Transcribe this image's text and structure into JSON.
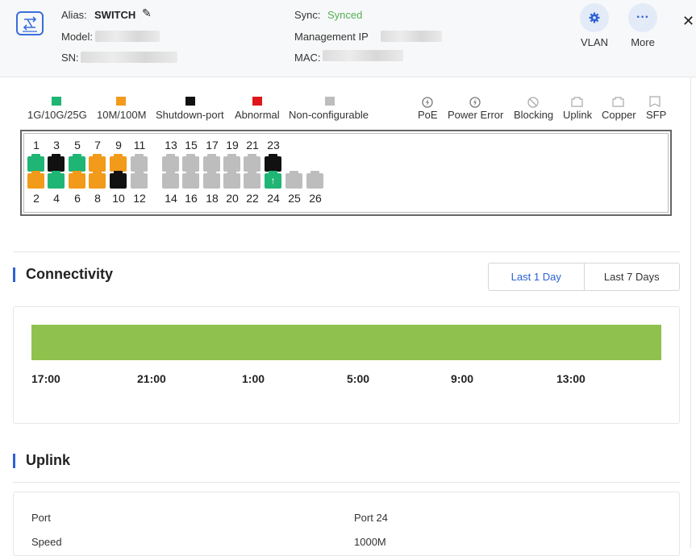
{
  "header": {
    "alias_label": "Alias:",
    "alias_value": "SWITCH",
    "model_label": "Model:",
    "sn_label": "SN:",
    "sync_label": "Sync:",
    "sync_value": "Synced",
    "mgmt_label": "Management IP",
    "mac_label": "MAC:",
    "vlan_label": "VLAN",
    "more_label": "More",
    "more_glyph": "···",
    "close_glyph": "✕",
    "sync_color": "#52b054",
    "accent": "#2d62d6"
  },
  "legend": {
    "speed": [
      {
        "label": "1G/10G/25G",
        "color": "#1fb574"
      },
      {
        "label": "10M/100M",
        "color": "#f29a1a"
      },
      {
        "label": "Shutdown-port",
        "color": "#111111"
      },
      {
        "label": "Abnormal",
        "color": "#e0161b"
      },
      {
        "label": "Non-configurable",
        "color": "#bdbdbd"
      }
    ],
    "status": [
      {
        "label": "PoE",
        "icon": "poe-icon"
      },
      {
        "label": "Power Error",
        "icon": "power-error-icon"
      },
      {
        "label": "Blocking",
        "icon": "blocking-icon"
      },
      {
        "label": "Uplink",
        "icon": "uplink-port-icon"
      },
      {
        "label": "Copper",
        "icon": "copper-port-icon"
      },
      {
        "label": "SFP",
        "icon": "sfp-port-icon"
      }
    ]
  },
  "ports": {
    "top_numbers": [
      "1",
      "3",
      "5",
      "7",
      "9",
      "11",
      "13",
      "15",
      "17",
      "19",
      "21",
      "23"
    ],
    "bottom_numbers": [
      "2",
      "4",
      "6",
      "8",
      "10",
      "12",
      "14",
      "16",
      "18",
      "20",
      "22",
      "24",
      "25",
      "26"
    ],
    "top_states": [
      "g",
      "k",
      "g",
      "o",
      "o",
      "s",
      "s",
      "s",
      "s",
      "s",
      "s",
      "k"
    ],
    "bottom_states": [
      "o",
      "g",
      "o",
      "o",
      "k",
      "s",
      "s",
      "s",
      "s",
      "s",
      "s",
      "g",
      "s",
      "s"
    ],
    "uplink_port": "24",
    "uplink_glyph": "↑"
  },
  "connectivity": {
    "title": "Connectivity",
    "tab_day": "Last 1 Day",
    "tab_week": "Last 7 Days",
    "bar_color": "#8fc14e",
    "times": [
      "17:00",
      "21:00",
      "1:00",
      "5:00",
      "9:00",
      "13:00"
    ]
  },
  "uplink": {
    "title": "Uplink",
    "rows": [
      {
        "label": "Port",
        "value": "Port 24"
      },
      {
        "label": "Speed",
        "value": "1000M"
      }
    ]
  }
}
